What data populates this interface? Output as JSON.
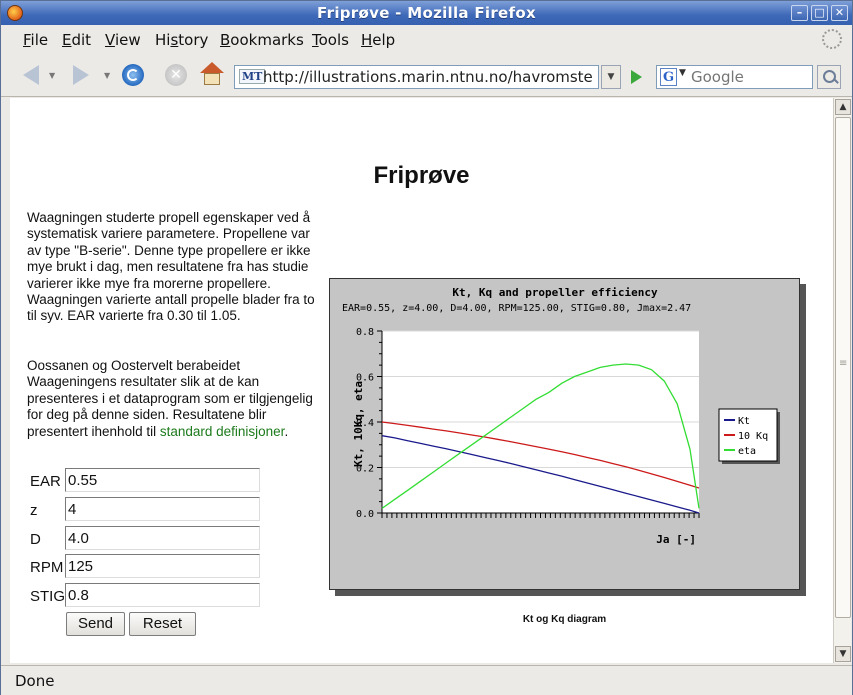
{
  "window": {
    "title": "Friprøve - Mozilla Firefox"
  },
  "menu": [
    {
      "label": "File",
      "accel": "F",
      "rest": "ile"
    },
    {
      "label": "Edit",
      "accel": "E",
      "rest": "dit"
    },
    {
      "label": "View",
      "accel": "V",
      "rest": "iew"
    },
    {
      "label": "History",
      "accel_pre": "Hi",
      "accel": "s",
      "rest": "tory"
    },
    {
      "label": "Bookmarks",
      "accel": "B",
      "rest": "ookmarks"
    },
    {
      "label": "Tools",
      "accel": "T",
      "rest": "ools"
    },
    {
      "label": "Help",
      "accel": "H",
      "rest": "elp"
    }
  ],
  "toolbar": {
    "url": "http://illustrations.marin.ntnu.no/havromsteknologi/",
    "url_badge": "MT",
    "search_placeholder": "Google"
  },
  "page": {
    "title": "Friprøve",
    "paragraph1": "Waagningen studerte propell egenskaper ved å systematisk variere parametere. Propellene var av type \"B-serie\". Denne type propellere er ikke mye brukt i dag, men resultatene fra has studie varierer ikke mye fra morerne propellere. Waagningen varierte antall propelle blader fra to til syv. EAR varierte fra 0.30 til 1.05.",
    "paragraph2": "Oossanen og Oostervelt berabeidet Waageningens resultater slik at de kan presenteres i et dataprogram som er tilgjengelig for deg på denne siden. Resultatene blir presentert ihenhold til ",
    "link": "standard definisjoner",
    "link_suffix": ".",
    "form": {
      "fields": [
        {
          "label": "EAR",
          "value": "0.55"
        },
        {
          "label": "z",
          "value": "4"
        },
        {
          "label": "D",
          "value": "4.0"
        },
        {
          "label": "RPM",
          "value": "125"
        },
        {
          "label": "STIG",
          "value": "0.8"
        }
      ],
      "send": "Send",
      "reset": "Reset"
    },
    "chart_caption": "Kt og Kq diagram"
  },
  "chart_data": {
    "type": "line",
    "title": "Kt, Kq and propeller efficiency",
    "subtitle": "EAR=0.55, z=4.00, D=4.00, RPM=125.00, STIG=0.80, Jmax=2.47",
    "xlabel": "Ja [-]",
    "ylabel": "Kt, 10Kq, eta",
    "ylim": [
      0,
      0.8
    ],
    "yticks": [
      "0.0",
      "0.2",
      "0.4",
      "0.6",
      "0.8"
    ],
    "grid": true,
    "legend_position": "right",
    "colors": {
      "Kt": "#1a1a8c",
      "10 Kq": "#cc1a1a",
      "eta": "#33dd33"
    },
    "x": [
      0.0,
      0.1,
      0.2,
      0.3,
      0.4,
      0.5,
      0.6,
      0.7,
      0.8,
      0.9,
      1.0,
      1.1,
      1.2,
      1.3,
      1.4,
      1.5,
      1.6,
      1.7,
      1.8,
      1.9,
      2.0,
      2.1,
      2.2,
      2.3,
      2.4,
      2.47
    ],
    "series": [
      {
        "name": "Kt",
        "values": [
          0.34,
          0.33,
          0.318,
          0.306,
          0.294,
          0.282,
          0.27,
          0.257,
          0.244,
          0.231,
          0.218,
          0.204,
          0.19,
          0.176,
          0.162,
          0.147,
          0.132,
          0.117,
          0.102,
          0.087,
          0.072,
          0.057,
          0.042,
          0.027,
          0.012,
          0.0
        ]
      },
      {
        "name": "10 Kq",
        "values": [
          0.4,
          0.393,
          0.385,
          0.377,
          0.369,
          0.361,
          0.352,
          0.343,
          0.334,
          0.324,
          0.314,
          0.303,
          0.292,
          0.281,
          0.269,
          0.257,
          0.244,
          0.231,
          0.217,
          0.203,
          0.188,
          0.172,
          0.156,
          0.139,
          0.122,
          0.11
        ]
      },
      {
        "name": "eta",
        "values": [
          0.02,
          0.06,
          0.1,
          0.14,
          0.18,
          0.22,
          0.26,
          0.3,
          0.34,
          0.38,
          0.42,
          0.46,
          0.5,
          0.53,
          0.57,
          0.6,
          0.62,
          0.64,
          0.65,
          0.655,
          0.65,
          0.63,
          0.58,
          0.48,
          0.28,
          0.02
        ]
      }
    ]
  },
  "status": {
    "text": "Done"
  }
}
